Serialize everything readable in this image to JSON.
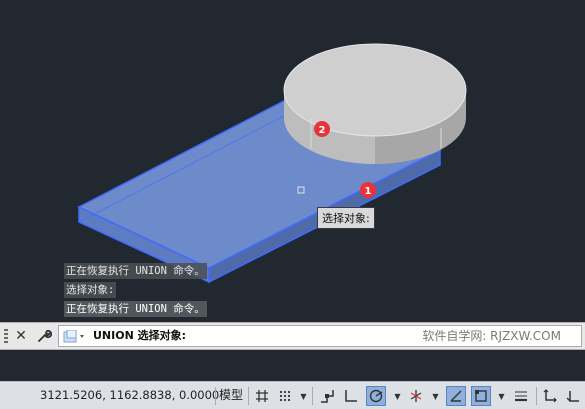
{
  "viewport": {
    "tooltip_text": "选择对象:",
    "markers": [
      "1",
      "2"
    ],
    "command_history": [
      "正在恢复执行 UNION 命令。",
      "选择对象:",
      "正在恢复执行 UNION 命令。"
    ]
  },
  "command_line": {
    "current_text": "UNION 选择对象:",
    "watermark": "软件自学网: RJZXW.COM"
  },
  "status_bar": {
    "coordinates": "3121.5206, 1162.8838, 0.0000",
    "model_label": "模型"
  },
  "colors": {
    "viewport_bg": "#212830",
    "selection_fill": "#7090d8",
    "selection_edge": "#3f6bff",
    "marker_red": "#e8333a",
    "cylinder_top": "#cfcfcf"
  }
}
